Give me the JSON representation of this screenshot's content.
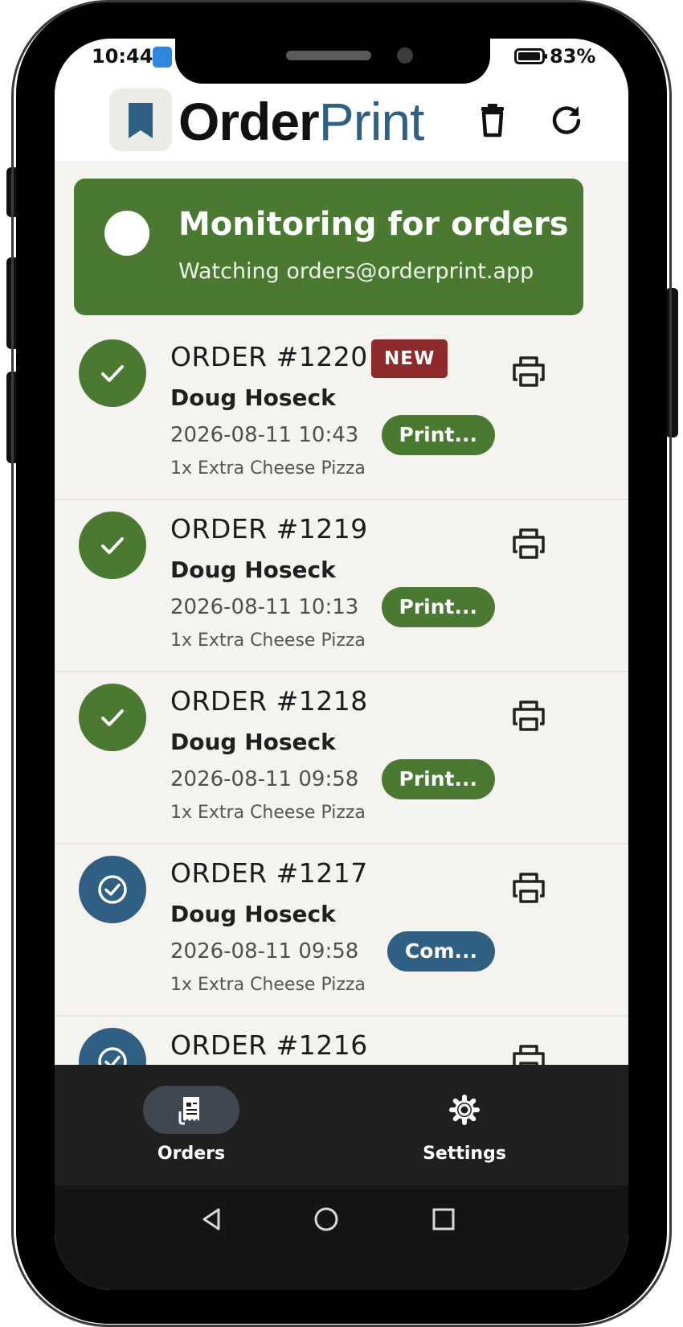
{
  "status_bar": {
    "time": "10:44",
    "battery": "83%"
  },
  "header": {
    "brand_bold": "Order",
    "brand_light": "Print"
  },
  "banner": {
    "title": "Monitoring for orders",
    "subtitle": "Watching orders@orderprint.app"
  },
  "orders": [
    {
      "number": "ORDER #1220",
      "badge": "NEW",
      "customer": "Doug Hoseck",
      "datetime": "2026-08-11  10:43",
      "status": "Print...",
      "items": "1x Extra Cheese Pizza"
    },
    {
      "number": "ORDER #1219",
      "customer": "Doug Hoseck",
      "datetime": "2026-08-11  10:13",
      "status": "Print...",
      "items": "1x Extra Cheese Pizza"
    },
    {
      "number": "ORDER #1218",
      "customer": "Doug Hoseck",
      "datetime": "2026-08-11  09:58",
      "status": "Print...",
      "items": "1x Extra Cheese Pizza"
    },
    {
      "number": "ORDER #1217",
      "customer": "Doug Hoseck",
      "datetime": "2026-08-11  09:58",
      "status": "Com...",
      "items": "1x Extra Cheese Pizza"
    },
    {
      "number": "ORDER #1216"
    }
  ],
  "nav": {
    "orders": "Orders",
    "settings": "Settings"
  },
  "colors": {
    "green": "#4a7a31",
    "blue": "#2f5f82",
    "new_badge": "#8f2a2a",
    "nav_bg": "#1f1f1e"
  }
}
